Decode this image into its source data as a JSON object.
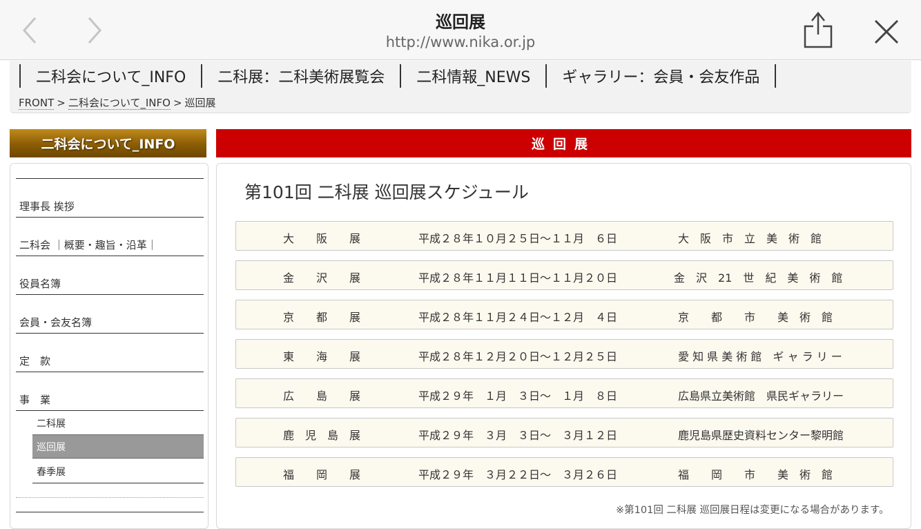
{
  "browser": {
    "title": "巡回展",
    "url": "http://www.nika.or.jp"
  },
  "global_nav": {
    "items": [
      "二科会について_INFO",
      "二科展：二科美術展覧会",
      "二科情報_NEWS",
      "ギャラリー：会員・会友作品"
    ]
  },
  "breadcrumb": {
    "front": "FRONT",
    "info": "二科会について_INFO",
    "current": "巡回展",
    "separator": ">"
  },
  "sidebar": {
    "title": "二科会について_INFO",
    "items": [
      "理事長 挨拶",
      "二科会 ｜概要・趣旨・沿革｜",
      "役員名簿",
      "会員・会友名簿",
      "定　款",
      "事　業"
    ],
    "sub_items": [
      "二科展",
      "巡回展",
      "春季展"
    ],
    "active_sub_item": "巡回展"
  },
  "main": {
    "title_bar": "巡回展",
    "schedule_title": "第101回 二科展 巡回展スケジュール",
    "schedule": [
      {
        "name": "大　　阪　　展",
        "date": "平成２８年１０月２５日～１１月　６日",
        "venue": "大　阪　市　立　美　術　館"
      },
      {
        "name": "金　　沢　　展",
        "date": "平成２８年１１月１１日～１１月２０日",
        "venue": "金　沢　21　世　紀　美　術　館"
      },
      {
        "name": "京　　都　　展",
        "date": "平成２８年１１月２４日～１２月　４日",
        "venue": "京　　都　　市　　美　術　館"
      },
      {
        "name": "東　　海　　展",
        "date": "平成２８年１２月２０日～１２月２５日",
        "venue": "愛 知 県 美 術 館　ギ ャ ラ リ ー"
      },
      {
        "name": "広　　島　　展",
        "date": "平成２９年　１月　３日～　１月　８日",
        "venue": "広島県立美術館　県民ギャラリー"
      },
      {
        "name": "鹿　児　島　展",
        "date": "平成２９年　３月　３日～　３月１２日",
        "venue": "鹿児島県歴史資料センター黎明館"
      },
      {
        "name": "福　　岡　　展",
        "date": "平成２９年　３月２２日～　３月２６日",
        "venue": "福　　岡　　市　　美　術　館"
      }
    ],
    "note": "※第101回 二科展 巡回展日程は変更になる場合があります。"
  },
  "colors": {
    "title_bar_red": "#cc0000",
    "sidebar_title_gold": "#8a5c05",
    "row_background": "#fcf9ef",
    "active_sub_item": "#999999"
  }
}
